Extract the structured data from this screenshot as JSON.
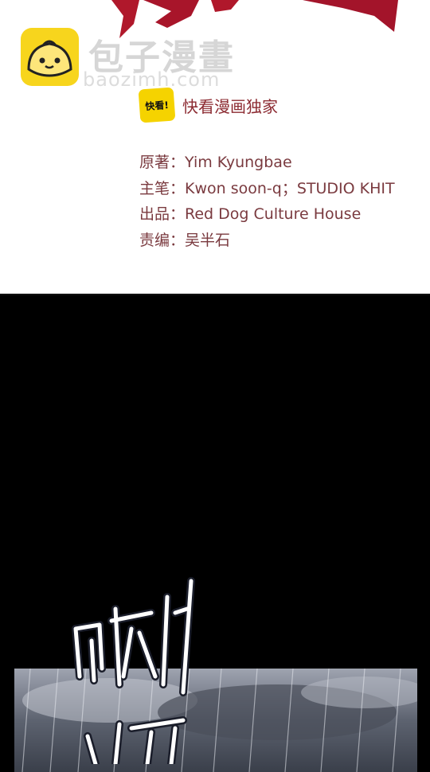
{
  "watermark": {
    "site_name": "包子漫畫",
    "site_url": "baozimh.com",
    "logo": "bun-face-logo"
  },
  "publisher": {
    "badge_text": "快看!",
    "name": "快看漫画独家"
  },
  "credits": [
    {
      "label": "原著：",
      "value": "Yim Kyungbae"
    },
    {
      "label": "主笔：",
      "value": "Kwon soon-q；STUDIO KHIT"
    },
    {
      "label": "出品：",
      "value": "Red Dog Culture House"
    },
    {
      "label": "责编：",
      "value": "吴半石"
    }
  ],
  "colors": {
    "title_red": "#b0182b",
    "credit_text": "#7a3a3f",
    "publisher_yellow": "#f5d300",
    "watermark_yellow": "#f7d51d"
  }
}
